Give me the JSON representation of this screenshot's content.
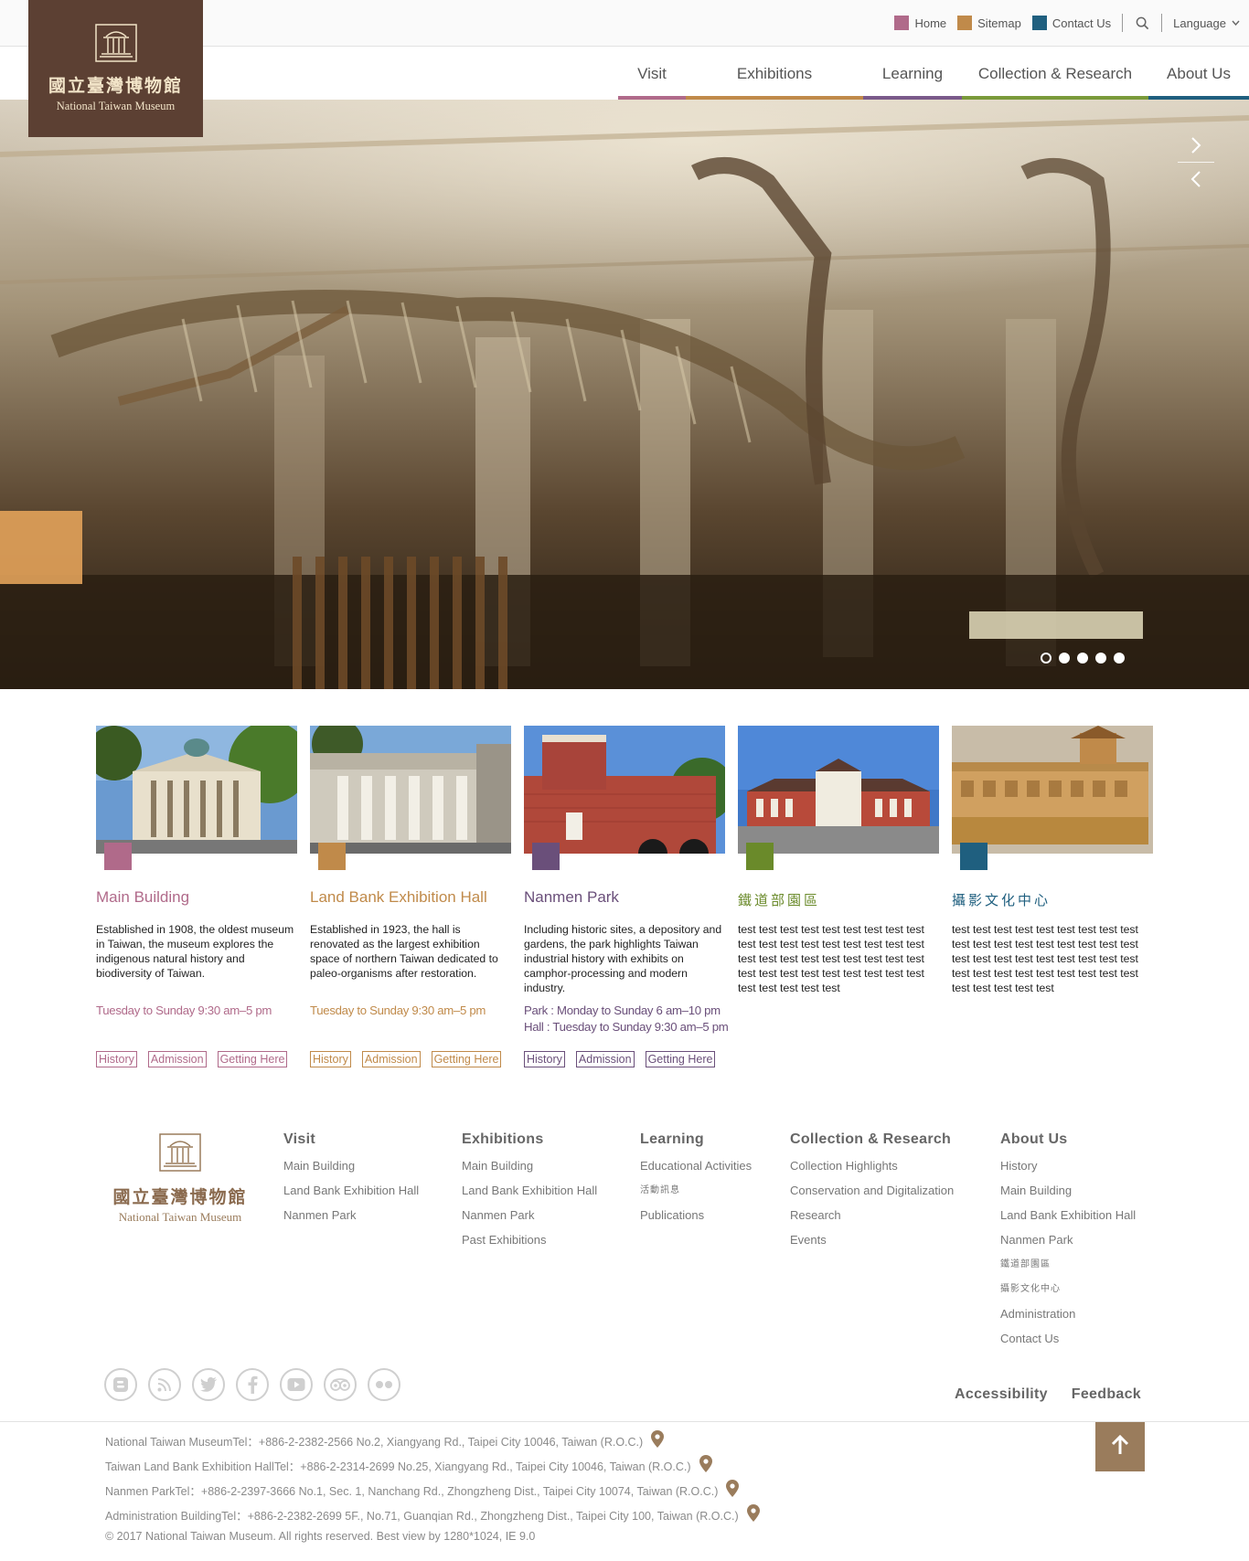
{
  "utility": {
    "links": [
      {
        "label": "Home",
        "color": "#b06a8a"
      },
      {
        "label": "Sitemap",
        "color": "#c08a4a"
      },
      {
        "label": "Contact Us",
        "color": "#1f5f7f"
      }
    ],
    "search_icon": "search-icon",
    "language_label": "Language"
  },
  "logo": {
    "zh": "國立臺灣博物館",
    "en": "National Taiwan Museum",
    "bg_color": "#5c4033"
  },
  "nav": [
    {
      "label": "Visit",
      "color": "#b06a8a"
    },
    {
      "label": "Exhibitions",
      "color": "#c08a4a"
    },
    {
      "label": "Learning",
      "color": "#7a5a8a"
    },
    {
      "label": "Collection & Research",
      "color": "#7a9a3a"
    },
    {
      "label": "About Us",
      "color": "#1f5f7f"
    }
  ],
  "hero": {
    "next_icon": "chevron-right-icon",
    "prev_icon": "chevron-left-icon",
    "slides": 5,
    "active_slide": 1
  },
  "venues": [
    {
      "title": "Main Building",
      "color": "#b06a8a",
      "desc": "Established in 1908, the oldest museum in Taiwan, the museum explores the indigenous natural history and biodiversity of Taiwan.",
      "hours": [
        "Tuesday to Sunday  9:30 am–5 pm"
      ],
      "buttons": [
        "History",
        "Admission",
        "Getting Here"
      ]
    },
    {
      "title": "Land Bank Exhibition Hall",
      "color": "#c08a4a",
      "desc": "Established in 1923, the hall is renovated as the largest exhibition space of northern Taiwan dedicated to paleo-organisms after restoration.",
      "hours": [
        "Tuesday to Sunday  9:30 am–5 pm"
      ],
      "buttons": [
        "History",
        "Admission",
        "Getting Here"
      ]
    },
    {
      "title": "Nanmen Park",
      "color": "#6a4f7a",
      "desc": "Including historic sites, a depository and gardens, the park highlights Taiwan industrial history with exhibits on camphor-processing and modern industry.",
      "hours": [
        "Park : Monday to Sunday   6  am–10 pm",
        "Hall : Tuesday to Sunday  9:30 am–5 pm"
      ],
      "buttons": [
        "History",
        "Admission",
        "Getting Here"
      ]
    },
    {
      "title": "鐵道部園區",
      "color": "#6a8a2a",
      "desc": "test test test test test test test test test test test test test test test test test test test test test test test test test test test test test test test test test test test test test test test test test",
      "hours": [],
      "buttons": []
    },
    {
      "title": "攝影文化中心",
      "color": "#1f5f7f",
      "desc": "test test test test test test test test test test test test test test test test test test test test test test test test test test test test test test test test test test test test test test test test test",
      "hours": [],
      "buttons": []
    }
  ],
  "footer": {
    "logo_zh": "國立臺灣博物館",
    "logo_en": "National Taiwan Museum",
    "columns": [
      {
        "title": "Visit",
        "links": [
          "Main Building",
          "Land Bank Exhibition Hall",
          "Nanmen Park"
        ]
      },
      {
        "title": "Exhibitions",
        "links": [
          "Main Building",
          "Land Bank Exhibition Hall",
          "Nanmen Park",
          "Past Exhibitions"
        ]
      },
      {
        "title": "Learning",
        "links": [
          "Educational Activities",
          "活動訊息",
          "Publications"
        ]
      },
      {
        "title": "Collection & Research",
        "links": [
          "Collection Highlights",
          "Conservation and Digitalization",
          "Research",
          "Events"
        ]
      },
      {
        "title": "About Us",
        "links": [
          "History",
          "Main Building",
          "Land Bank Exhibition Hall",
          "Nanmen Park",
          "鐵道部園區",
          "攝影文化中心",
          "Administration",
          "Contact Us"
        ]
      }
    ],
    "social_icons": [
      "blogger-icon",
      "rss-icon",
      "twitter-icon",
      "facebook-icon",
      "youtube-icon",
      "tripadvisor-icon",
      "flickr-icon"
    ],
    "accessibility_label": "Accessibility",
    "feedback_label": "Feedback",
    "addresses": [
      "National Taiwan MuseumTel：+886-2-2382-2566     No.2, Xiangyang Rd., Taipei City 10046, Taiwan (R.O.C.)",
      "Taiwan Land Bank Exhibition HallTel：+886-2-2314-2699     No.25, Xiangyang Rd., Taipei City 10046, Taiwan (R.O.C.)",
      "Nanmen ParkTel：+886-2-2397-3666     No.1, Sec. 1, Nanchang Rd., Zhongzheng Dist., Taipei City 10074, Taiwan (R.O.C.)",
      "Administration BuildingTel：+886-2-2382-2699     5F., No.71, Guanqian Rd., Zhongzheng Dist., Taipei City 100, Taiwan (R.O.C.)"
    ],
    "copyright": "© 2017 National Taiwan Museum. All rights reserved. Best view by 1280*1024, IE 9.0",
    "accent_color": "#9a7c5c"
  }
}
